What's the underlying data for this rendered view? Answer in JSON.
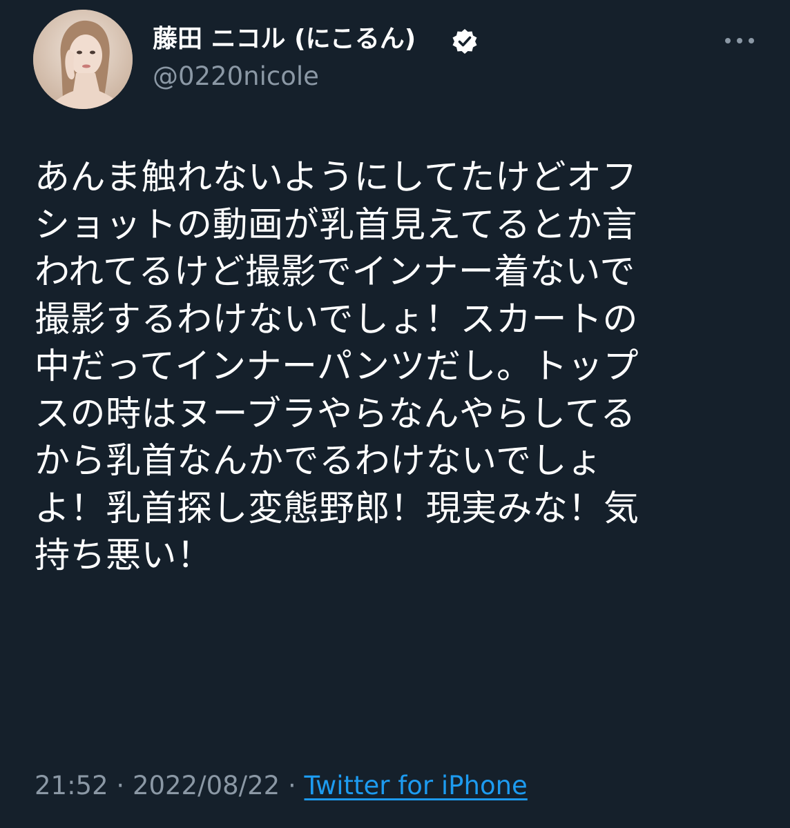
{
  "author": {
    "display_name": "藤田 ニコル (にこるん)",
    "handle": "@0220nicole",
    "verified": true,
    "avatar_icon": "profile-photo"
  },
  "tweet": {
    "lines": [
      "あんま触れないようにしてたけどオフ",
      "ショットの動画が乳首見えてるとか言",
      "われてるけど撮影でインナー着ないで",
      "撮影するわけないでしょ！スカートの",
      "中だってインナーパンツだし。トップ",
      "スの時はヌーブラやらなんやらしてる",
      "から乳首なんかでるわけないでしょ",
      "よ！乳首探し変態野郎！現実みな！気",
      "持ち悪い！"
    ]
  },
  "meta": {
    "time": "21:52",
    "separator_1": " · ",
    "date": "2022/08/22",
    "separator_2": " · ",
    "source": "Twitter for iPhone"
  },
  "colors": {
    "background": "#15202b",
    "text": "#ffffff",
    "secondary_text": "#8b98a5",
    "link": "#1d9bf0"
  },
  "icons": {
    "verified": "verified-badge-icon",
    "more": "more-options-icon"
  }
}
